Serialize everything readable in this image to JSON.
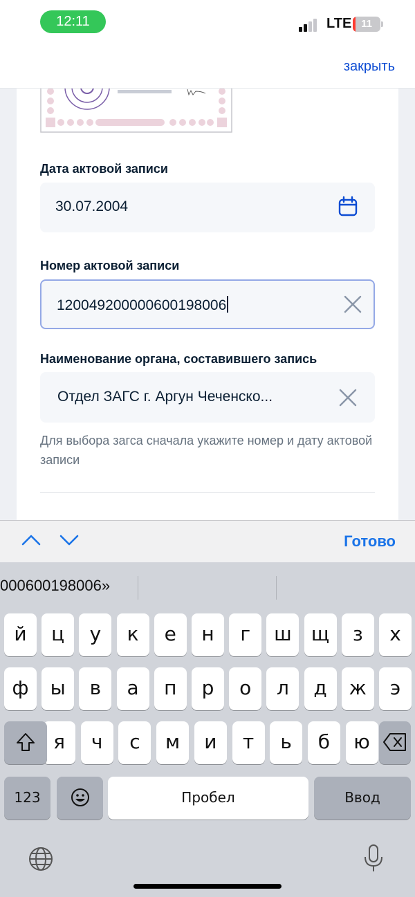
{
  "status_bar": {
    "time": "12:11",
    "network": "LTE",
    "battery_level": "11",
    "battery_fraction": 0.11
  },
  "header": {
    "close_label": "закрыть",
    "accent_color": "#0d4cd3"
  },
  "form": {
    "record_date": {
      "label": "Дата актовой записи",
      "value": "30.07.2004"
    },
    "record_number": {
      "label": "Номер актовой записи",
      "value": "120049200000600198006"
    },
    "authority": {
      "label": "Наименование органа, составившего запись",
      "value": "Отдел ЗАГС г. Аргун Чеченско..."
    },
    "hint": "Для выбора загса сначала укажите номер и дату актовой записи"
  },
  "keyboard_toolbar": {
    "done_label": "Готово"
  },
  "keyboard": {
    "prediction": "000600198006»",
    "row1": [
      "й",
      "ц",
      "у",
      "к",
      "е",
      "н",
      "г",
      "ш",
      "щ",
      "з",
      "х"
    ],
    "row2": [
      "ф",
      "ы",
      "в",
      "а",
      "п",
      "р",
      "о",
      "л",
      "д",
      "ж",
      "э"
    ],
    "row3": [
      "я",
      "ч",
      "с",
      "м",
      "и",
      "т",
      "ь",
      "б",
      "ю"
    ],
    "numbers_label": "123",
    "space_label": "Пробел",
    "return_label": "Ввод"
  }
}
